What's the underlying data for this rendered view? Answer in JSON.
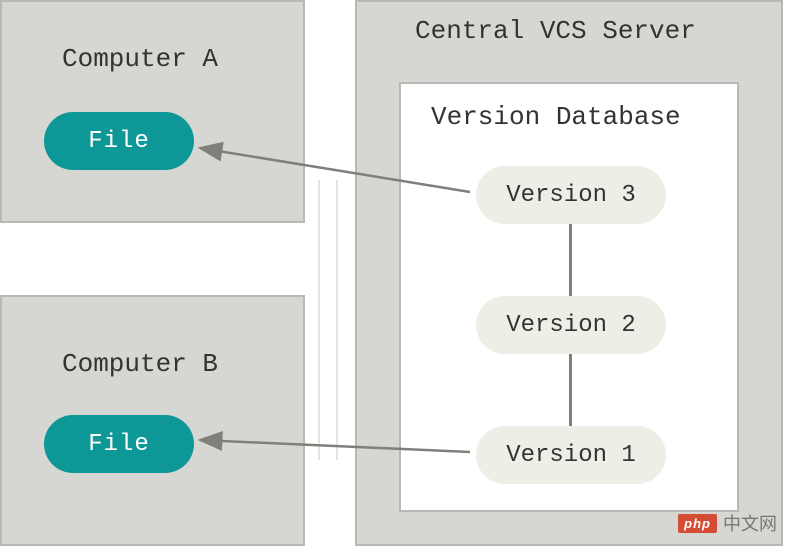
{
  "computerA": {
    "title": "Computer A",
    "file": "File"
  },
  "computerB": {
    "title": "Computer B",
    "file": "File"
  },
  "server": {
    "title": "Central VCS Server",
    "db": {
      "title": "Version Database",
      "versions": {
        "v3": "Version 3",
        "v2": "Version 2",
        "v1": "Version 1"
      }
    }
  },
  "watermark": {
    "logo": "php",
    "text": "中文网"
  },
  "colors": {
    "panel_bg": "#d6d6d3",
    "panel_border": "#b8b8b5",
    "file_bg": "#0e9797",
    "version_bg": "#efeee6",
    "connector": "#807f7a"
  }
}
